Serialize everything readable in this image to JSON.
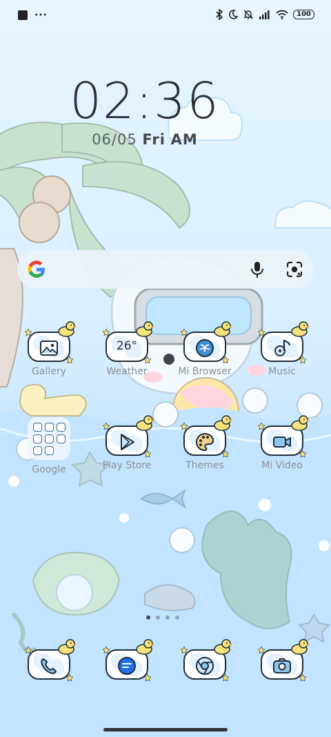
{
  "status_bar": {
    "left_icons": [
      "square-icon",
      "more-dots-icon"
    ],
    "right_icons": [
      "bluetooth-icon",
      "moon-icon",
      "bell-off-icon",
      "signal-icon",
      "wifi-icon"
    ],
    "battery": "100"
  },
  "clock": {
    "time": "02:36",
    "date": "06/05",
    "weekday": "Fri",
    "ampm": "AM"
  },
  "search": {
    "icons": [
      "google-logo-icon",
      "mic-icon",
      "lens-icon"
    ]
  },
  "apps_row1": [
    {
      "label": "Gallery",
      "icon": "gallery-icon"
    },
    {
      "label": "Weather",
      "icon": "weather-icon",
      "text": "26°"
    },
    {
      "label": "Mi Browser",
      "icon": "browser-icon"
    },
    {
      "label": "Music",
      "icon": "music-icon"
    }
  ],
  "apps_row2": [
    {
      "label": "Google",
      "icon": "folder-icon"
    },
    {
      "label": "Play Store",
      "icon": "play-store-icon"
    },
    {
      "label": "Themes",
      "icon": "palette-icon"
    },
    {
      "label": "Mi Video",
      "icon": "video-icon"
    }
  ],
  "dock": [
    {
      "icon": "phone-icon"
    },
    {
      "icon": "messages-icon"
    },
    {
      "icon": "chrome-icon"
    },
    {
      "icon": "camera-icon"
    }
  ],
  "page_indicator": {
    "count": 4,
    "active_index": 0
  },
  "colors": {
    "outline": "#1f2e3a",
    "duck": "#f6e27a",
    "sky": "#d9efff",
    "water": "#c2e4ff"
  }
}
